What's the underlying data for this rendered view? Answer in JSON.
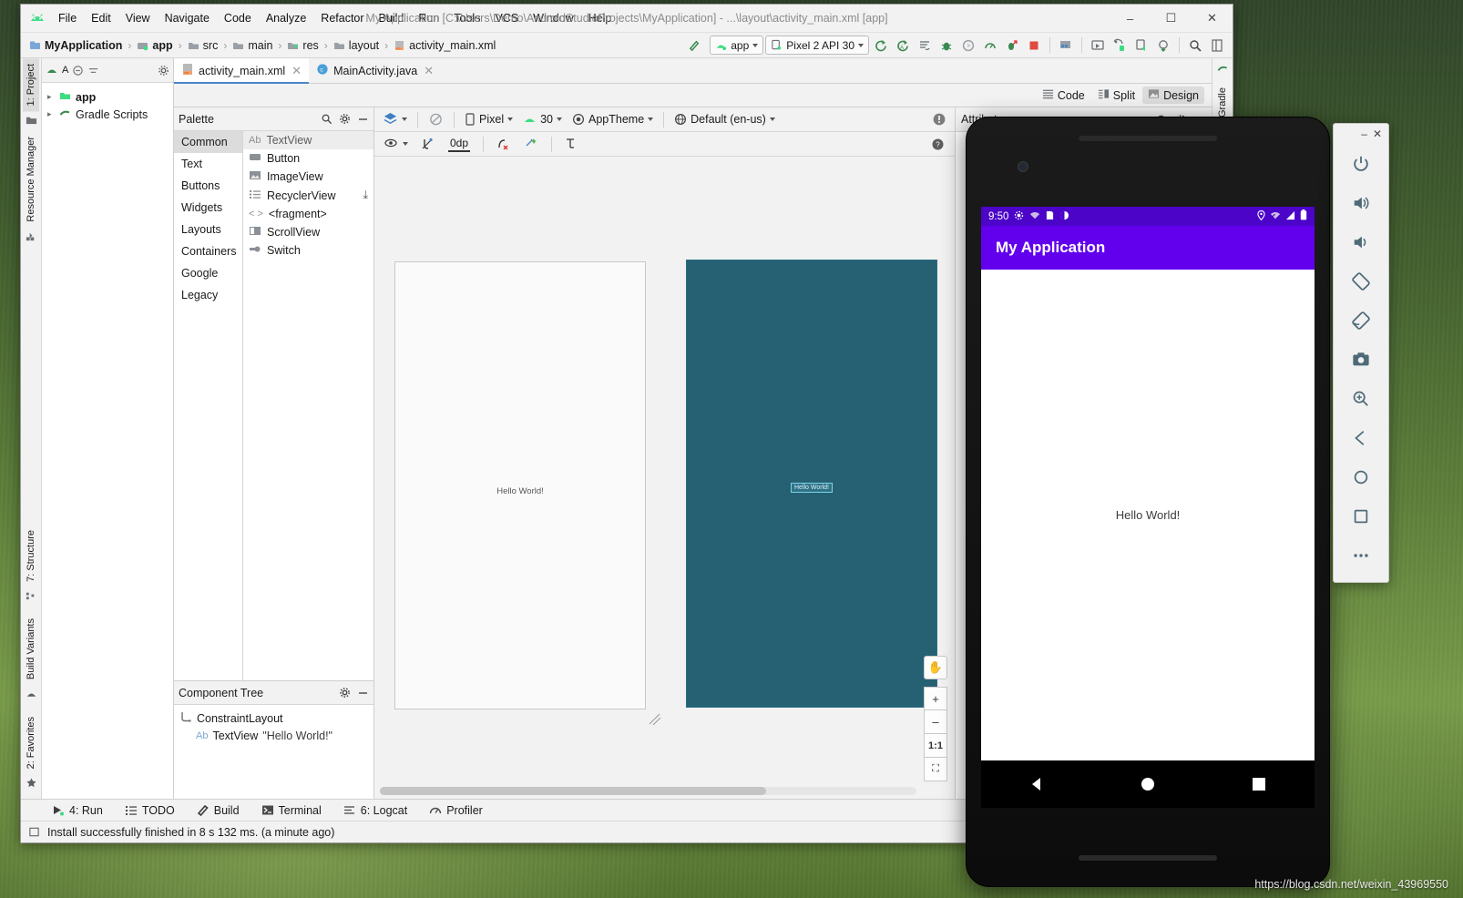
{
  "window": {
    "title": "My Application [C:\\Users\\Demo\\AndroidStudioProjects\\MyApplication] - ...\\layout\\activity_main.xml [app]",
    "minimize": "–",
    "maximize": "☐",
    "close": "✕"
  },
  "menu": [
    {
      "label": "File"
    },
    {
      "label": "Edit"
    },
    {
      "label": "View"
    },
    {
      "label": "Navigate"
    },
    {
      "label": "Code"
    },
    {
      "label": "Analyze"
    },
    {
      "label": "Refactor"
    },
    {
      "label": "Build"
    },
    {
      "label": "Run"
    },
    {
      "label": "Tools"
    },
    {
      "label": "VCS"
    },
    {
      "label": "Window"
    },
    {
      "label": "Help"
    }
  ],
  "breadcrumb": [
    {
      "label": "MyApplication"
    },
    {
      "label": "app"
    },
    {
      "label": "src"
    },
    {
      "label": "main"
    },
    {
      "label": "res"
    },
    {
      "label": "layout"
    },
    {
      "label": "activity_main.xml"
    }
  ],
  "breadcrumb_separator": "›",
  "toolbar": {
    "run_config": "app",
    "device": "Pixel 2 API 30",
    "icons": [
      "build-hammer-icon",
      "run-icon",
      "run-coverage-icon",
      "apply-changes-icon",
      "debug-icon",
      "attach-debugger-icon",
      "profile-icon",
      "apply-code-changes-icon",
      "stop-icon",
      "sdk-manager-icon",
      "avd-manager-icon",
      "device-file-explorer-icon",
      "layout-inspector-icon",
      "sync-gradle-icon",
      "search-everywhere-icon",
      "project-structure-icon"
    ]
  },
  "left_strip": {
    "tabs": [
      {
        "label": "1: Project",
        "active": true
      },
      {
        "label": "Resource Manager",
        "active": false
      }
    ],
    "bottom_tabs": [
      {
        "label": "7: Structure"
      },
      {
        "label": "Build Variants"
      },
      {
        "label": "2: Favorites"
      }
    ]
  },
  "right_strip": {
    "tabs": [
      {
        "label": "Gradle"
      }
    ]
  },
  "project_panel": {
    "nodes": [
      {
        "label": "app",
        "bold": true
      },
      {
        "label": "Gradle Scripts",
        "bold": false
      }
    ]
  },
  "editor_tabs": [
    {
      "label": "activity_main.xml",
      "icon": "xml-layout-icon",
      "active": true,
      "close": "✕"
    },
    {
      "label": "MainActivity.java",
      "icon": "java-class-icon",
      "active": false,
      "close": "✕"
    }
  ],
  "view_modes": [
    {
      "label": "Code",
      "icon": "code-mode-icon",
      "active": false
    },
    {
      "label": "Split",
      "icon": "split-mode-icon",
      "active": false
    },
    {
      "label": "Design",
      "icon": "design-mode-icon",
      "active": true
    }
  ],
  "palette": {
    "title": "Palette",
    "categories": [
      {
        "label": "Common",
        "active": true
      },
      {
        "label": "Text",
        "active": false
      },
      {
        "label": "Buttons",
        "active": false
      },
      {
        "label": "Widgets",
        "active": false
      },
      {
        "label": "Layouts",
        "active": false
      },
      {
        "label": "Containers",
        "active": false
      },
      {
        "label": "Google",
        "active": false
      },
      {
        "label": "Legacy",
        "active": false
      }
    ],
    "items": [
      {
        "label": "TextView",
        "icon": "textview-icon",
        "selected": true,
        "download": false
      },
      {
        "label": "Button",
        "icon": "button-icon",
        "selected": false,
        "download": false
      },
      {
        "label": "ImageView",
        "icon": "imageview-icon",
        "selected": false,
        "download": false
      },
      {
        "label": "RecyclerView",
        "icon": "recyclerview-icon",
        "selected": false,
        "download": true
      },
      {
        "label": "<fragment>",
        "icon": "fragment-icon",
        "selected": false,
        "download": false
      },
      {
        "label": "ScrollView",
        "icon": "scrollview-icon",
        "selected": false,
        "download": false
      },
      {
        "label": "Switch",
        "icon": "switch-icon",
        "selected": false,
        "download": false
      }
    ],
    "download_glyph": "⤓"
  },
  "component_tree": {
    "title": "Component Tree",
    "rows": [
      {
        "label": "ConstraintLayout",
        "icon": "constraintlayout-icon",
        "value": "",
        "indent": false
      },
      {
        "label": "TextView",
        "icon": "textview-icon",
        "value": "\"Hello World!\"",
        "indent": true
      }
    ]
  },
  "surface_toolbar": {
    "design_modes_icon": "design-blueprint-icon",
    "orientation_icon": "rotate-no-icon",
    "device": "Pixel",
    "api_level": "30",
    "theme": "AppTheme",
    "locale": "Default (en-us)",
    "warning_icon": "warning-info-icon",
    "help_icon": "help-icon",
    "row2": [
      {
        "label": "",
        "icon": "view-options-icon"
      },
      {
        "label": "",
        "icon": "autoconnect-off-icon"
      },
      {
        "label": "0dp",
        "icon": "default-margin"
      },
      {
        "label": "",
        "icon": "clear-constraints-icon"
      },
      {
        "label": "",
        "icon": "infer-constraints-icon"
      },
      {
        "label": "",
        "icon": "guidelines-icon"
      }
    ]
  },
  "canvas": {
    "design_preview": {
      "name": "design-preview",
      "text": "Hello World!"
    },
    "blueprint_preview": {
      "name": "blueprint-preview",
      "text": "Hello World!"
    },
    "zoom_controls": [
      {
        "label": "✋",
        "name": "pan-tool-button"
      },
      {
        "label": "+",
        "name": "zoom-in-button"
      },
      {
        "label": "–",
        "name": "zoom-out-button"
      },
      {
        "label": "1:1",
        "name": "zoom-actual-size-button"
      },
      {
        "label": "⛶",
        "name": "zoom-to-fit-button"
      }
    ]
  },
  "attributes": {
    "title": "Attributes",
    "icons": [
      "search-icon",
      "gear-icon",
      "minimize-icon"
    ]
  },
  "bottom_tools": [
    {
      "label": "4: Run",
      "icon": "run-icon",
      "underline": "4"
    },
    {
      "label": "TODO",
      "icon": "todo-icon",
      "underline": ""
    },
    {
      "label": "Build",
      "icon": "build-icon",
      "underline": ""
    },
    {
      "label": "Terminal",
      "icon": "terminal-icon",
      "underline": ""
    },
    {
      "label": "6: Logcat",
      "icon": "logcat-icon",
      "underline": "6"
    },
    {
      "label": "Profiler",
      "icon": "profiler-icon",
      "underline": ""
    }
  ],
  "status": {
    "message": "Install successfully finished in 8 s 132 ms. (a minute ago)",
    "icon": "event-log-icon"
  },
  "emulator": {
    "status_bar": {
      "time": "9:50",
      "left_icons": [
        "settings-icon",
        "wifi-off-icon",
        "sim-card-icon",
        "do-not-disturb-icon"
      ],
      "right_icons": [
        "location-icon",
        "wifi-off-icon",
        "cellular-signal-icon",
        "battery-icon"
      ]
    },
    "app_bar_title": "My Application",
    "content_text": "Hello World!",
    "nav_buttons": [
      {
        "name": "back-button",
        "shape": "triangle"
      },
      {
        "name": "home-button",
        "shape": "circle"
      },
      {
        "name": "recents-button",
        "shape": "square"
      }
    ],
    "accent_color": "#6200ee",
    "status_bar_color": "#4b04c8"
  },
  "emulator_tools": {
    "minimize": "–",
    "close": "✕",
    "buttons": [
      {
        "name": "power-button",
        "icon": "power-icon"
      },
      {
        "name": "volume-up-button",
        "icon": "volume-up-icon"
      },
      {
        "name": "volume-down-button",
        "icon": "volume-down-icon"
      },
      {
        "name": "rotate-left-button",
        "icon": "rotate-left-icon"
      },
      {
        "name": "rotate-right-button",
        "icon": "rotate-right-icon"
      },
      {
        "name": "screenshot-button",
        "icon": "camera-icon"
      },
      {
        "name": "zoom-button",
        "icon": "zoom-icon"
      },
      {
        "name": "back-button",
        "icon": "back-triangle-icon"
      },
      {
        "name": "home-button",
        "icon": "home-circle-icon"
      },
      {
        "name": "overview-button",
        "icon": "overview-square-icon"
      },
      {
        "name": "extended-controls-button",
        "icon": "more-icon"
      }
    ]
  },
  "watermark": "https://blog.csdn.net/weixin_43969550"
}
